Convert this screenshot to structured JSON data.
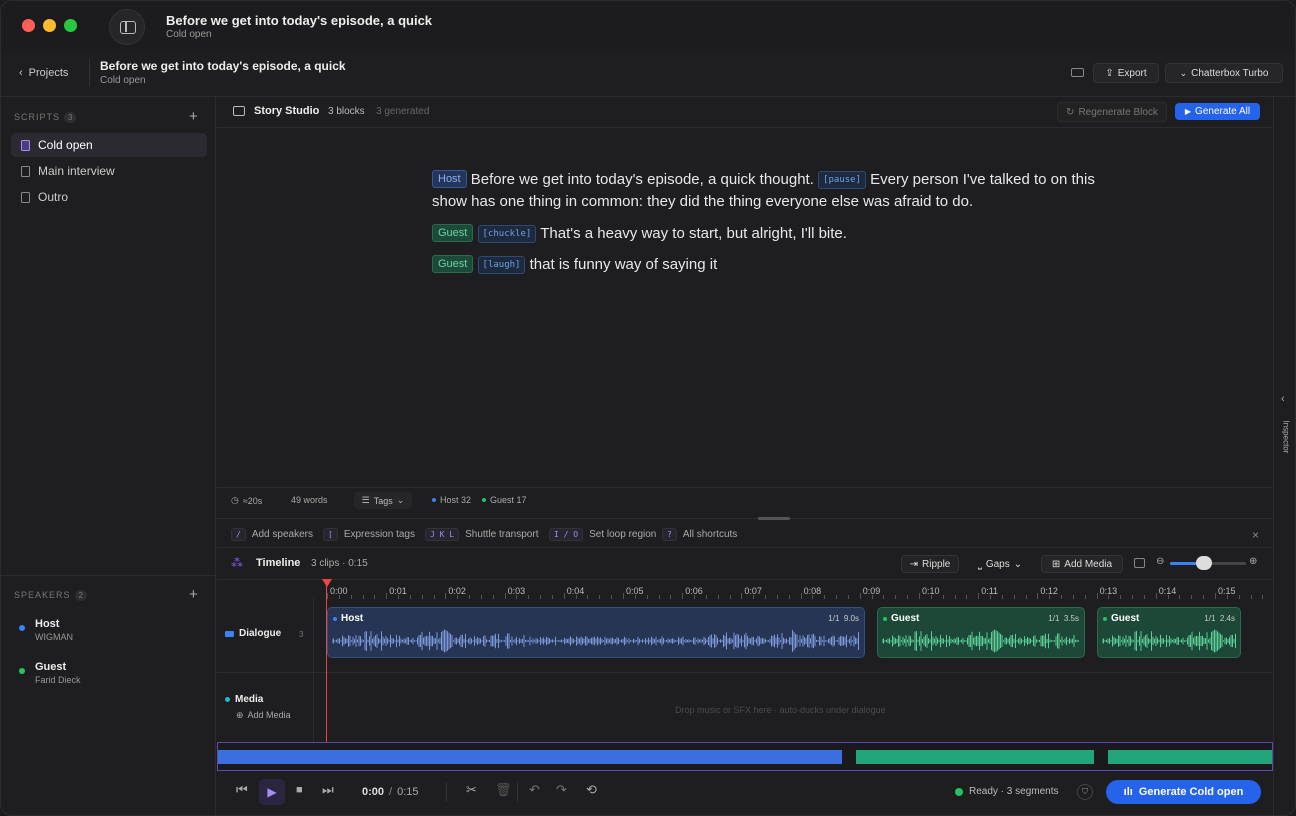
{
  "window": {
    "title": "Before we get into today's episode, a quick",
    "subtitle": "Cold open"
  },
  "header": {
    "back_label": "Projects",
    "title": "Before we get into today's episode, a quick",
    "subtitle": "Cold open",
    "export_label": "Export",
    "model_label": "Chatterbox Turbo"
  },
  "sidebar": {
    "scripts_label": "SCRIPTS",
    "scripts_count": "3",
    "scripts": [
      {
        "label": "Cold open"
      },
      {
        "label": "Main interview"
      },
      {
        "label": "Outro"
      }
    ],
    "speakers_label": "SPEAKERS",
    "speakers_count": "2",
    "speakers": [
      {
        "name": "Host",
        "voice": "WIGMAN",
        "color": "#3b82f6"
      },
      {
        "name": "Guest",
        "voice": "Farid Dieck",
        "color": "#22c55e"
      }
    ]
  },
  "studio": {
    "title": "Story Studio",
    "blocks": "3 blocks",
    "generated": "3 generated",
    "regenerate_label": "Regenerate Block",
    "generate_all_label": "Generate All"
  },
  "script": {
    "host_tag": "Host",
    "line1_a": "Before we get into today's episode, a quick thought.",
    "pause_tag": "[pause]",
    "line1_b": "Every person I've talked to on this show has one thing in common: they did the thing everyone else was afraid to do.",
    "guest_tag": "Guest",
    "chuckle_tag": "[chuckle]",
    "line2": "That's a heavy way to start, but alright, I'll bite.",
    "laugh_tag": "[laugh]",
    "line3": "that is funny way of saying it"
  },
  "stats": {
    "duration": "≈20s",
    "words": "49 words",
    "tags_label": "Tags",
    "host_count": "Host 32",
    "guest_count": "Guest 17"
  },
  "shortcuts": [
    {
      "key": "/",
      "label": "Add speakers"
    },
    {
      "key": "[",
      "label": "Expression tags"
    },
    {
      "key": "J K L",
      "label": "Shuttle transport"
    },
    {
      "key": "I / O",
      "label": "Set loop region"
    },
    {
      "key": "?",
      "label": "All shortcuts"
    }
  ],
  "timeline": {
    "title": "Timeline",
    "info": "3 clips · 0:15",
    "ripple_label": "Ripple",
    "gaps_label": "Gaps",
    "add_media_label": "Add Media",
    "zoom": 0.45,
    "ticks": [
      "0:00",
      "0:01",
      "0:02",
      "0:03",
      "0:04",
      "0:05",
      "0:06",
      "0:07",
      "0:08",
      "0:09",
      "0:10",
      "0:11",
      "0:12",
      "0:13",
      "0:14",
      "0:15"
    ],
    "dialogue_label": "Dialogue",
    "dialogue_count": "3",
    "media_label": "Media",
    "media_add_label": "Add Media",
    "media_hint": "Drop music or SFX here · auto-ducks under dialogue",
    "clips": [
      {
        "name": "Host",
        "take": "1/1",
        "dur": "9.0s"
      },
      {
        "name": "Guest",
        "take": "1/1",
        "dur": "3.5s"
      },
      {
        "name": "Guest",
        "take": "1/1",
        "dur": "2.4s"
      }
    ]
  },
  "transport": {
    "current": "0:00",
    "sep": "/",
    "total": "0:15",
    "status": "Ready · 3 segments",
    "generate_label": "Generate Cold open"
  },
  "inspector_label": "Inspector",
  "colors": {
    "accent": "#2563eb",
    "host": "#3b82f6",
    "guest": "#22c55e",
    "playhead": "#ef4444"
  }
}
